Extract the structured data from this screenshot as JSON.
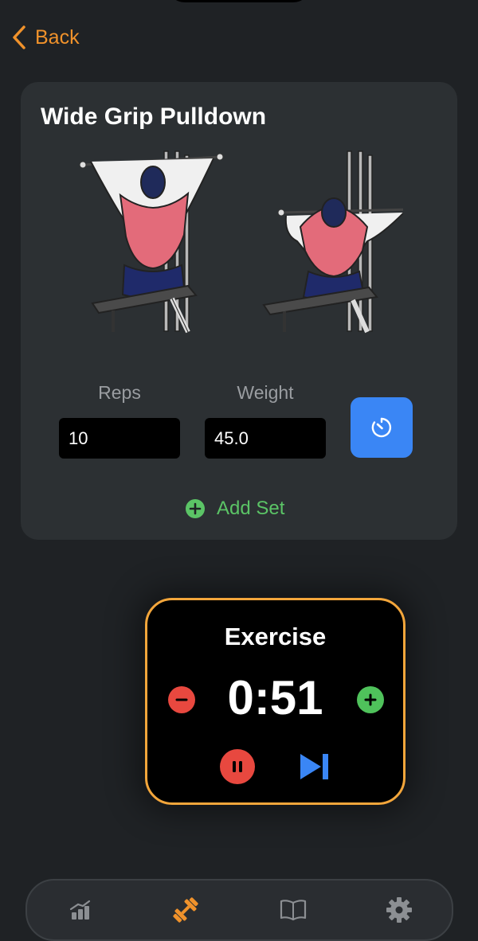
{
  "nav": {
    "back_label": "Back"
  },
  "exercise": {
    "title": "Wide Grip Pulldown",
    "reps_label": "Reps",
    "weight_label": "Weight",
    "reps_value": "10",
    "weight_value": "45.0",
    "add_set_label": "Add Set"
  },
  "timer": {
    "title": "Exercise",
    "value": "0:51"
  },
  "tabs": [
    {
      "icon": "progress-chart-icon",
      "active": false
    },
    {
      "icon": "dumbbell-icon",
      "active": true
    },
    {
      "icon": "book-icon",
      "active": false
    },
    {
      "icon": "gear-icon",
      "active": false
    }
  ],
  "colors": {
    "accent": "#f0922b",
    "background": "#1f2225",
    "card": "#2c3033",
    "timer_button": "#3a86f5",
    "add_green": "#5bc466",
    "minus_red": "#e8483f",
    "timer_border": "#f3a63b"
  }
}
